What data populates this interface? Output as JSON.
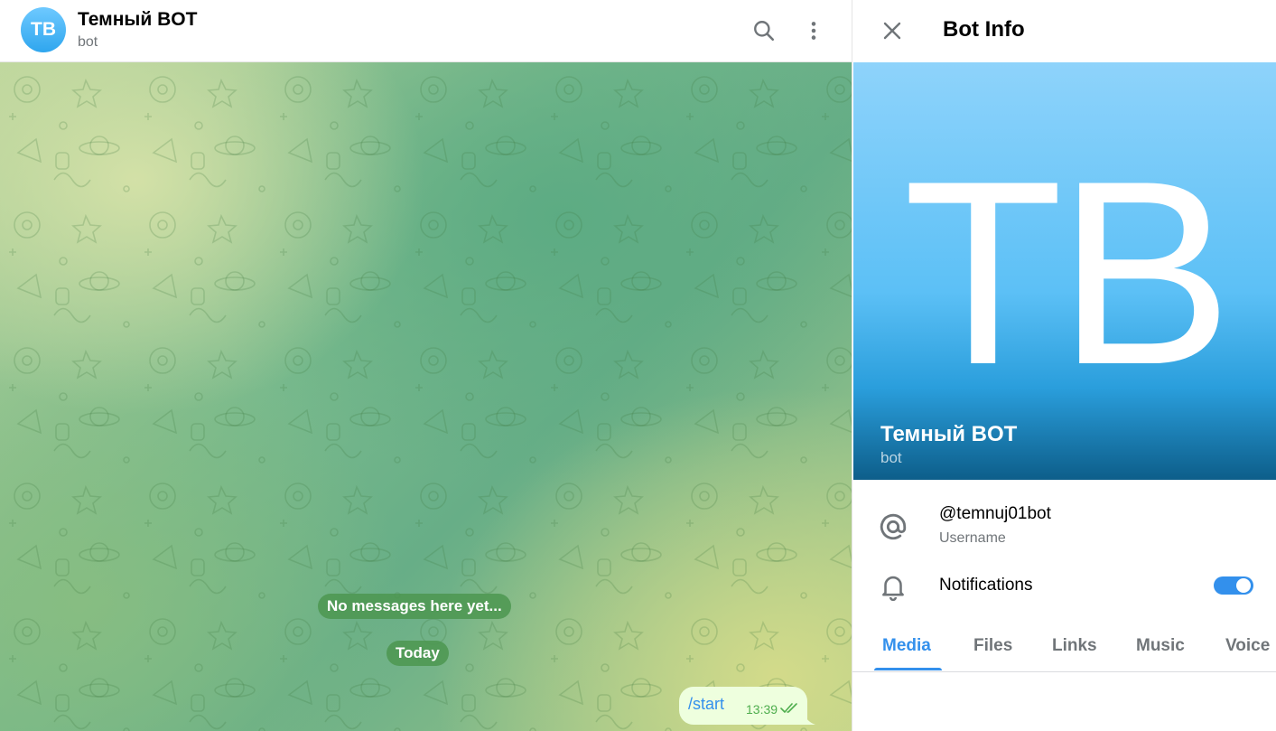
{
  "chat": {
    "avatar_initials": "TB",
    "title": "Темный BOT",
    "status": "bot",
    "empty_notice": "No messages here yet...",
    "date_separator": "Today",
    "messages": [
      {
        "text": "/start",
        "time": "13:39",
        "outgoing": true,
        "read": true
      }
    ]
  },
  "header_icons": [
    "search-icon",
    "more-vertical-icon"
  ],
  "info_panel": {
    "title": "Bot Info",
    "close_icon": "close-icon",
    "hero_initials": "TB",
    "name": "Темный BOT",
    "subtitle": "bot",
    "username": "@temnuj01bot",
    "username_label": "Username",
    "notifications_label": "Notifications",
    "notifications_enabled": true,
    "tabs": [
      "Media",
      "Files",
      "Links",
      "Music",
      "Voice"
    ],
    "active_tab": "Media"
  },
  "colors": {
    "accent": "#3390ec",
    "outgoing_bubble": "#eeffde",
    "service_pill": "#4c9650"
  }
}
